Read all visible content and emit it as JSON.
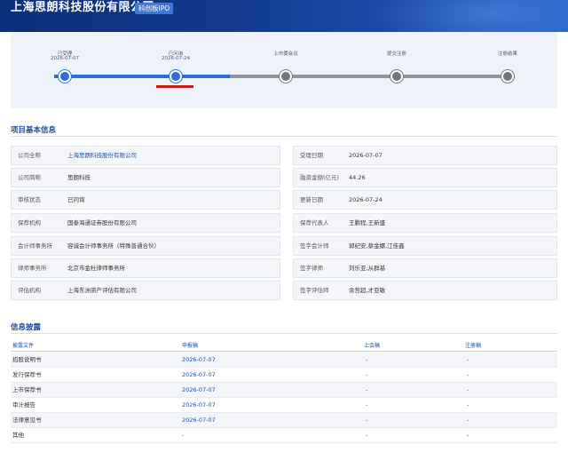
{
  "header": {
    "company_title": "上海思朗科技股份有限公司",
    "board_tag": "科创板IPO"
  },
  "progress": {
    "completed_fraction": 0.25,
    "steps": [
      {
        "label": "已受理",
        "date": "2026-07-07",
        "state": "done"
      },
      {
        "label": "已问询",
        "date": "2026-07-24",
        "state": "current"
      },
      {
        "label": "上市委会议",
        "date": "",
        "state": "todo"
      },
      {
        "label": "提交注册",
        "date": "",
        "state": "todo"
      },
      {
        "label": "注册结果",
        "date": "",
        "state": "todo"
      }
    ]
  },
  "project_info": {
    "title": "项目基本信息",
    "left": [
      {
        "label": "公司全称",
        "value": "上海思朗科技股份有限公司",
        "link": true
      },
      {
        "label": "公司简称",
        "value": "思朗科技",
        "link": false
      },
      {
        "label": "审核状态",
        "value": "已问询",
        "link": false
      },
      {
        "label": "保荐机构",
        "value": "国泰海通证券股份有限公司",
        "link": false
      },
      {
        "label": "会计师事务所",
        "value": "容诚会计师事务所（特殊普通合伙）",
        "link": false
      },
      {
        "label": "律师事务所",
        "value": "北京市金杜律师事务所",
        "link": false
      },
      {
        "label": "评估机构",
        "value": "上海东洲资产评估有限公司",
        "link": false
      }
    ],
    "right": [
      {
        "label": "受理日期",
        "value": "2026-07-07"
      },
      {
        "label": "融资金额(亿元)",
        "value": "44.26"
      },
      {
        "label": "更新日期",
        "value": "2026-07-24"
      },
      {
        "label": "保荐代表人",
        "value": "王鹏程,王新盛"
      },
      {
        "label": "签字会计师",
        "value": "郭纪安,蔡金嫘,江佳鑫"
      },
      {
        "label": "签字律师",
        "value": "刘乐亚,从群基"
      },
      {
        "label": "签字评估师",
        "value": "余哲超,才亚敏"
      }
    ]
  },
  "disclosure": {
    "title": "信息披露",
    "columns": [
      "披露文件",
      "申报稿",
      "上会稿",
      "注册稿"
    ],
    "rows": [
      {
        "doc": "招股说明书",
        "filing": "2026-07-07",
        "meeting": "-",
        "registration": "-"
      },
      {
        "doc": "发行保荐书",
        "filing": "2026-07-07",
        "meeting": "-",
        "registration": "-"
      },
      {
        "doc": "上市保荐书",
        "filing": "2026-07-07",
        "meeting": "-",
        "registration": "-"
      },
      {
        "doc": "审计报告",
        "filing": "2026-07-07",
        "meeting": "-",
        "registration": "-"
      },
      {
        "doc": "法律意见书",
        "filing": "2026-07-07",
        "meeting": "-",
        "registration": "-"
      },
      {
        "doc": "其他",
        "filing": "-",
        "meeting": "-",
        "registration": "-"
      }
    ]
  },
  "colors": {
    "header_bg": "#123a8c",
    "accent_blue": "#2b6fd6",
    "link_blue": "#1b4fa8",
    "pending_gray": "#6f767e",
    "current_marker_red": "#c81e1e"
  }
}
